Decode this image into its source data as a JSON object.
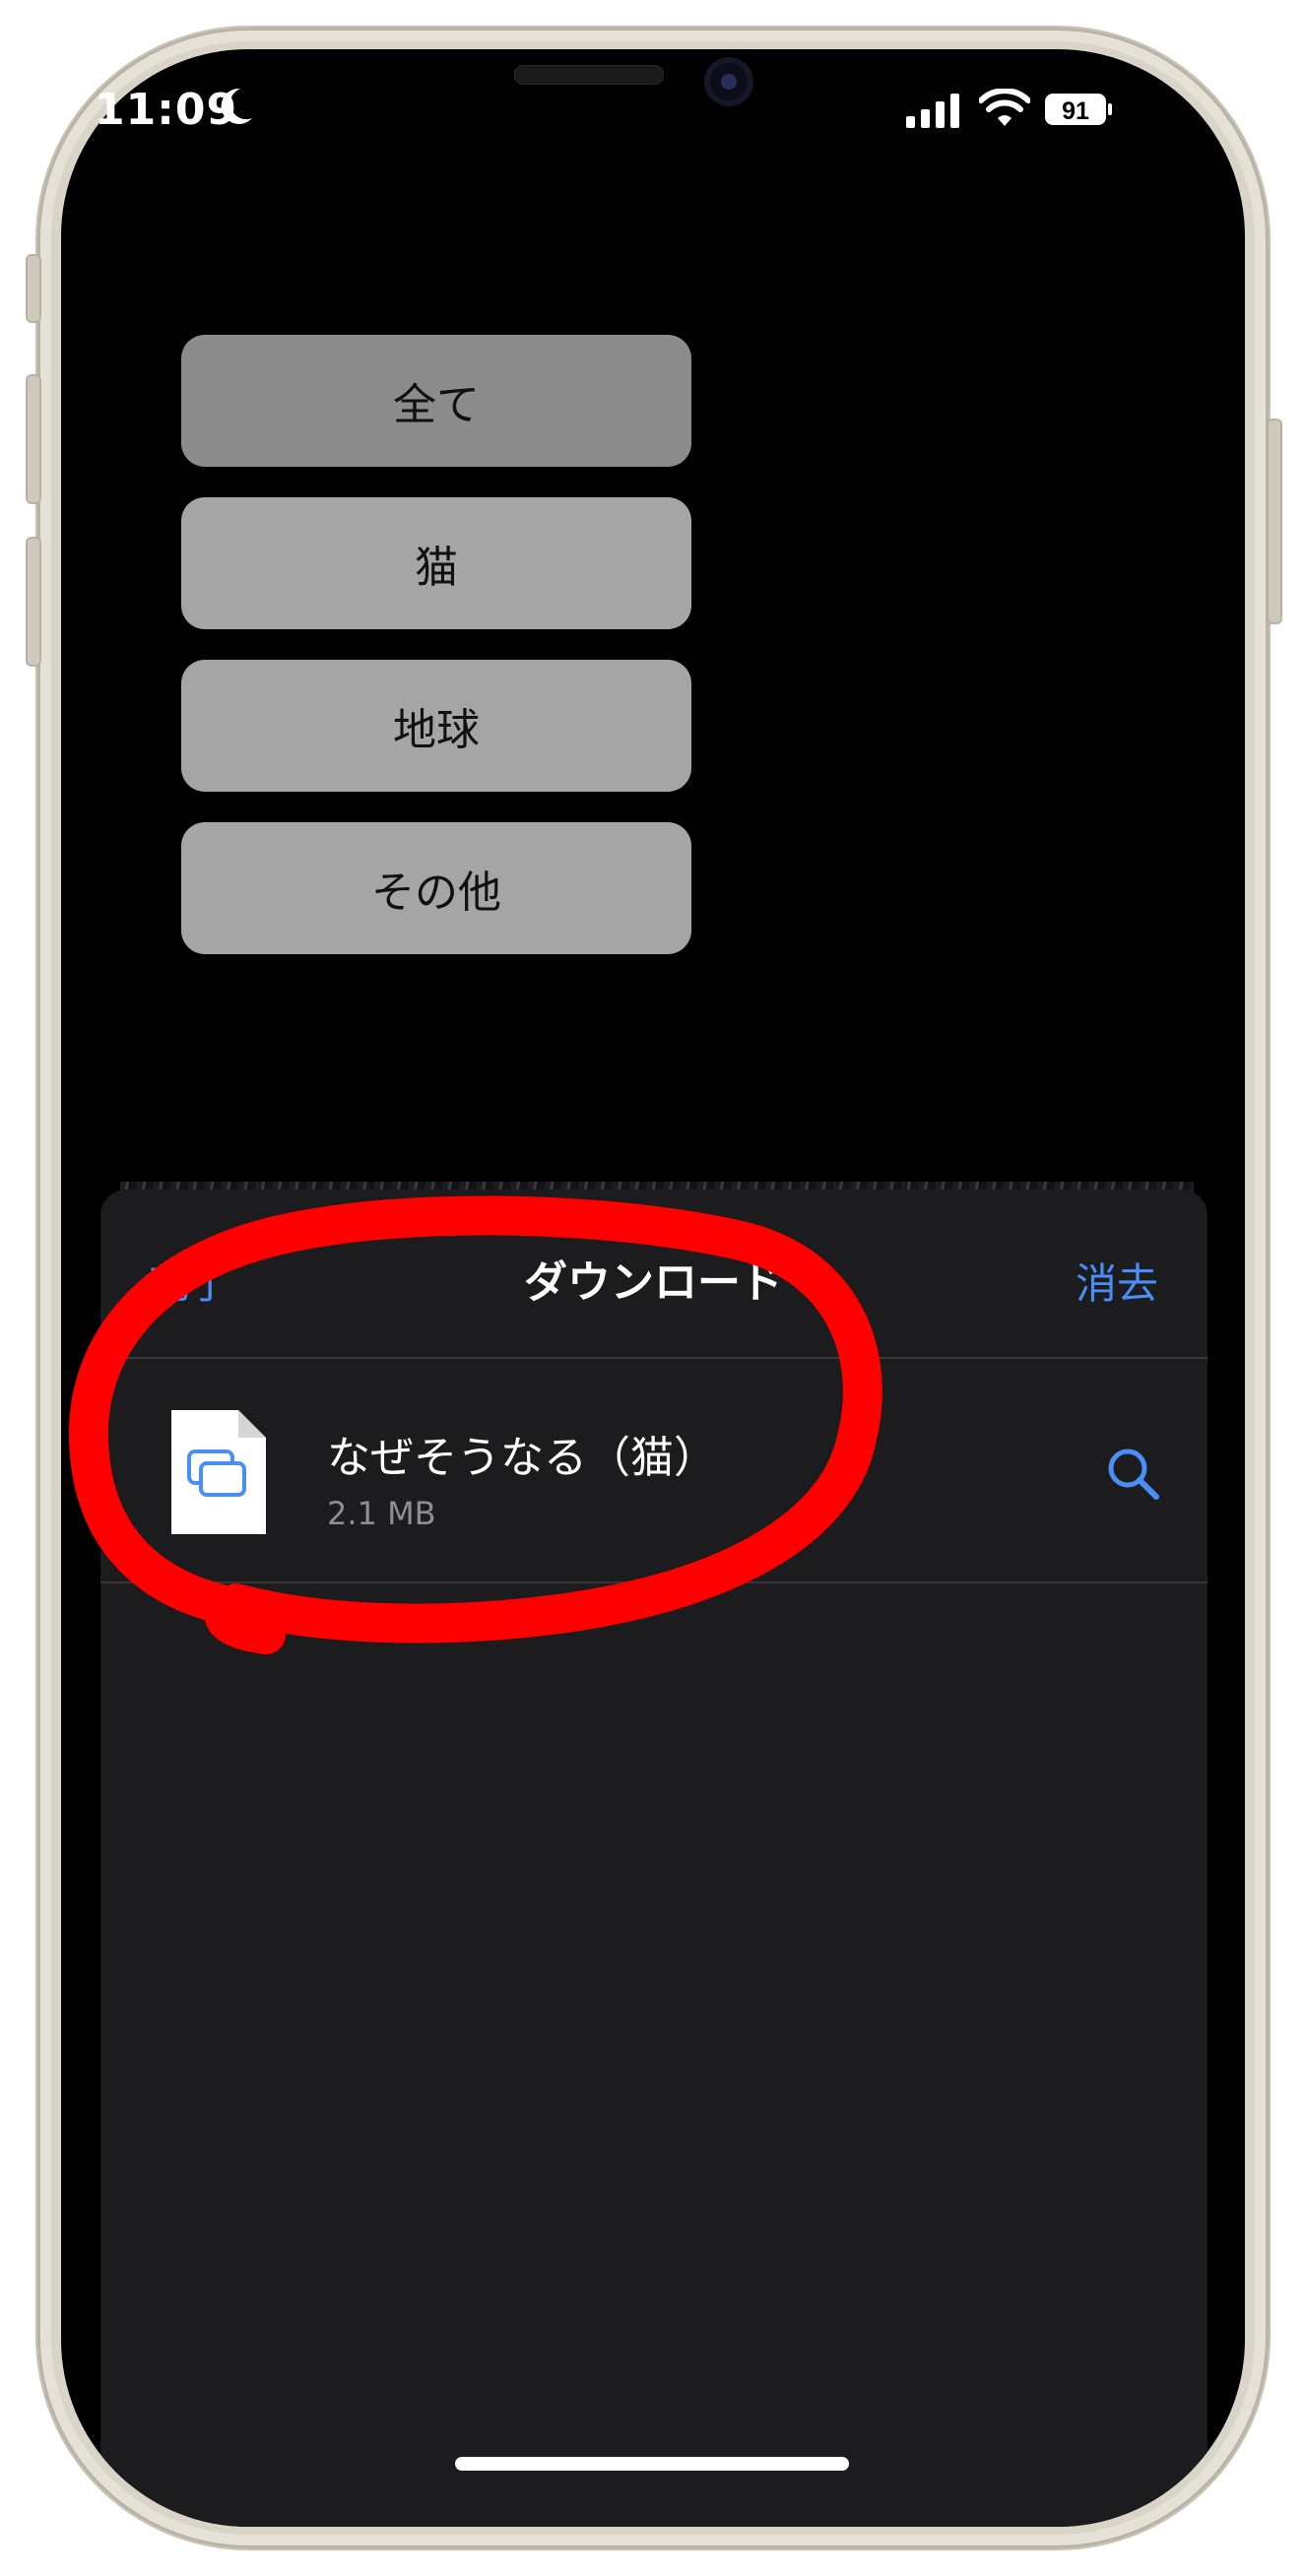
{
  "status_bar": {
    "time": "11:09",
    "battery": "91",
    "icons": [
      "moon-icon",
      "cellular-signal-icon",
      "wifi-icon",
      "battery-icon"
    ]
  },
  "filters": {
    "items": [
      {
        "label": "全て",
        "active": true
      },
      {
        "label": "猫",
        "active": false
      },
      {
        "label": "地球",
        "active": false
      },
      {
        "label": "その他",
        "active": false
      }
    ]
  },
  "downloads_sheet": {
    "done_label": "完了",
    "title": "ダウンロード",
    "clear_label": "消去",
    "items": [
      {
        "name": "なぜそうなる（猫）",
        "size": "2.1 MB",
        "icon": "file-document-icon",
        "action_icon": "search-icon"
      }
    ]
  },
  "colors": {
    "accent": "#4a8ff5",
    "sheet_background": "#1c1c1e",
    "annotation_stroke": "#ff0000"
  }
}
